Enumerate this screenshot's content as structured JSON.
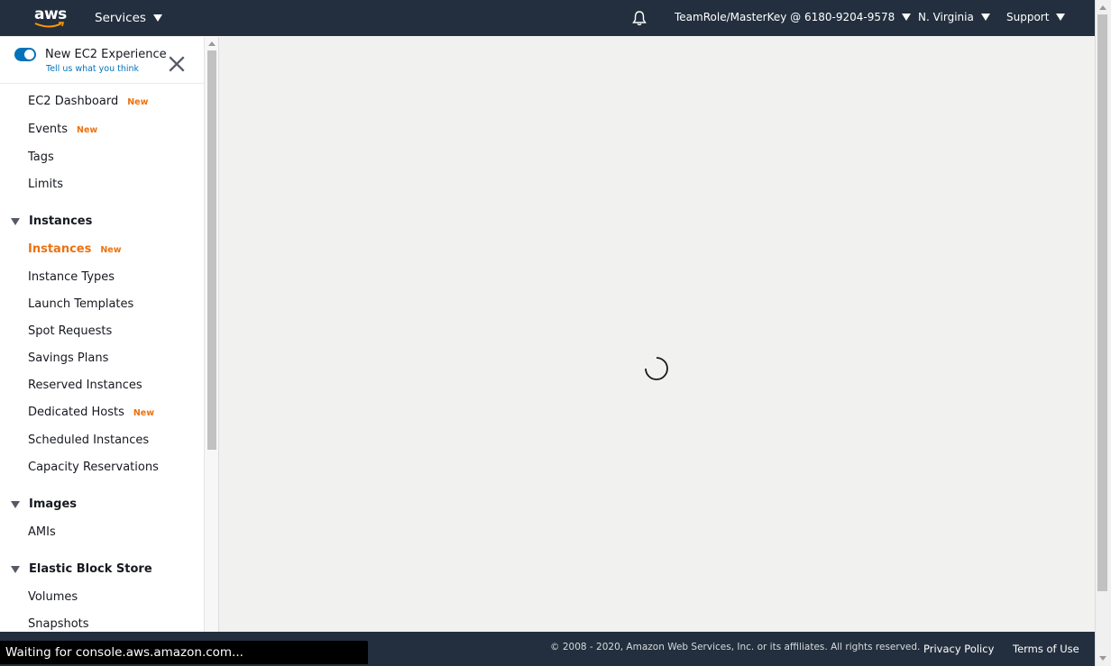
{
  "header": {
    "logo_text": "aws",
    "services_label": "Services",
    "account_label": "TeamRole/MasterKey @ 6180-9204-9578",
    "region_label": "N. Virginia",
    "support_label": "Support",
    "icons": [
      "aws-logo",
      "bell-icon"
    ]
  },
  "sidebar": {
    "toggle_title": "New EC2 Experience",
    "toggle_link": "Tell us what you think",
    "toggle_on": true,
    "items_top": [
      {
        "label": "EC2 Dashboard",
        "badge": "New"
      },
      {
        "label": "Events",
        "badge": "New"
      },
      {
        "label": "Tags",
        "badge": ""
      },
      {
        "label": "Limits",
        "badge": ""
      }
    ],
    "sections": [
      {
        "title": "Instances",
        "items": [
          {
            "label": "Instances",
            "badge": "New",
            "active": true
          },
          {
            "label": "Instance Types",
            "badge": ""
          },
          {
            "label": "Launch Templates",
            "badge": ""
          },
          {
            "label": "Spot Requests",
            "badge": ""
          },
          {
            "label": "Savings Plans",
            "badge": ""
          },
          {
            "label": "Reserved Instances",
            "badge": ""
          },
          {
            "label": "Dedicated Hosts",
            "badge": "New"
          },
          {
            "label": "Scheduled Instances",
            "badge": ""
          },
          {
            "label": "Capacity Reservations",
            "badge": ""
          }
        ]
      },
      {
        "title": "Images",
        "items": [
          {
            "label": "AMIs",
            "badge": ""
          }
        ]
      },
      {
        "title": "Elastic Block Store",
        "items": [
          {
            "label": "Volumes",
            "badge": ""
          },
          {
            "label": "Snapshots",
            "badge": ""
          }
        ]
      }
    ]
  },
  "footer": {
    "copyright": "© 2008 - 2020, Amazon Web Services, Inc. or its affiliates. All rights reserved.",
    "privacy_label": "Privacy Policy",
    "terms_label": "Terms of Use"
  },
  "status_bar": {
    "text": "Waiting for console.aws.amazon.com..."
  },
  "colors": {
    "nav_bg": "#232f3e",
    "accent_orange": "#ec7211",
    "toggle_blue": "#0073bb",
    "main_bg": "#f1f2f0"
  }
}
